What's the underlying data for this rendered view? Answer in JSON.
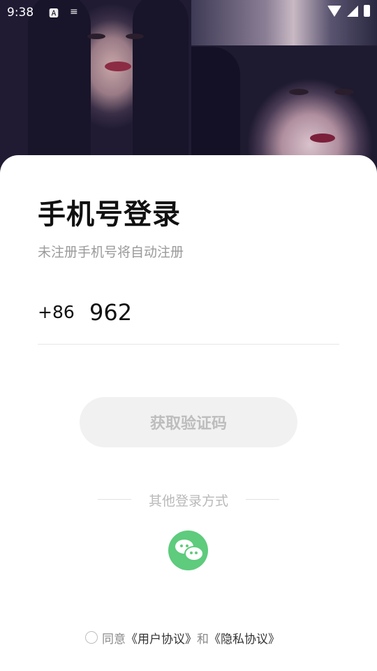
{
  "status_bar": {
    "time": "9:38",
    "icons": [
      "a-icon",
      "notification-icon",
      "wifi-icon",
      "signal-icon",
      "battery-icon"
    ]
  },
  "login": {
    "title": "手机号登录",
    "subtitle": "未注册手机号将自动注册",
    "country_code": "+86",
    "phone_value": "962",
    "get_code_label": "获取验证码",
    "other_methods_label": "其他登录方式",
    "wechat_icon": "wechat-icon"
  },
  "agreement": {
    "prefix": "同意",
    "user_agreement": "《用户协议》",
    "conjunction": "和",
    "privacy_policy": "《隐私协议》"
  },
  "colors": {
    "accent_green": "#5ecb7d",
    "button_bg": "#f1f1f1",
    "button_text": "#bdbdbd"
  }
}
